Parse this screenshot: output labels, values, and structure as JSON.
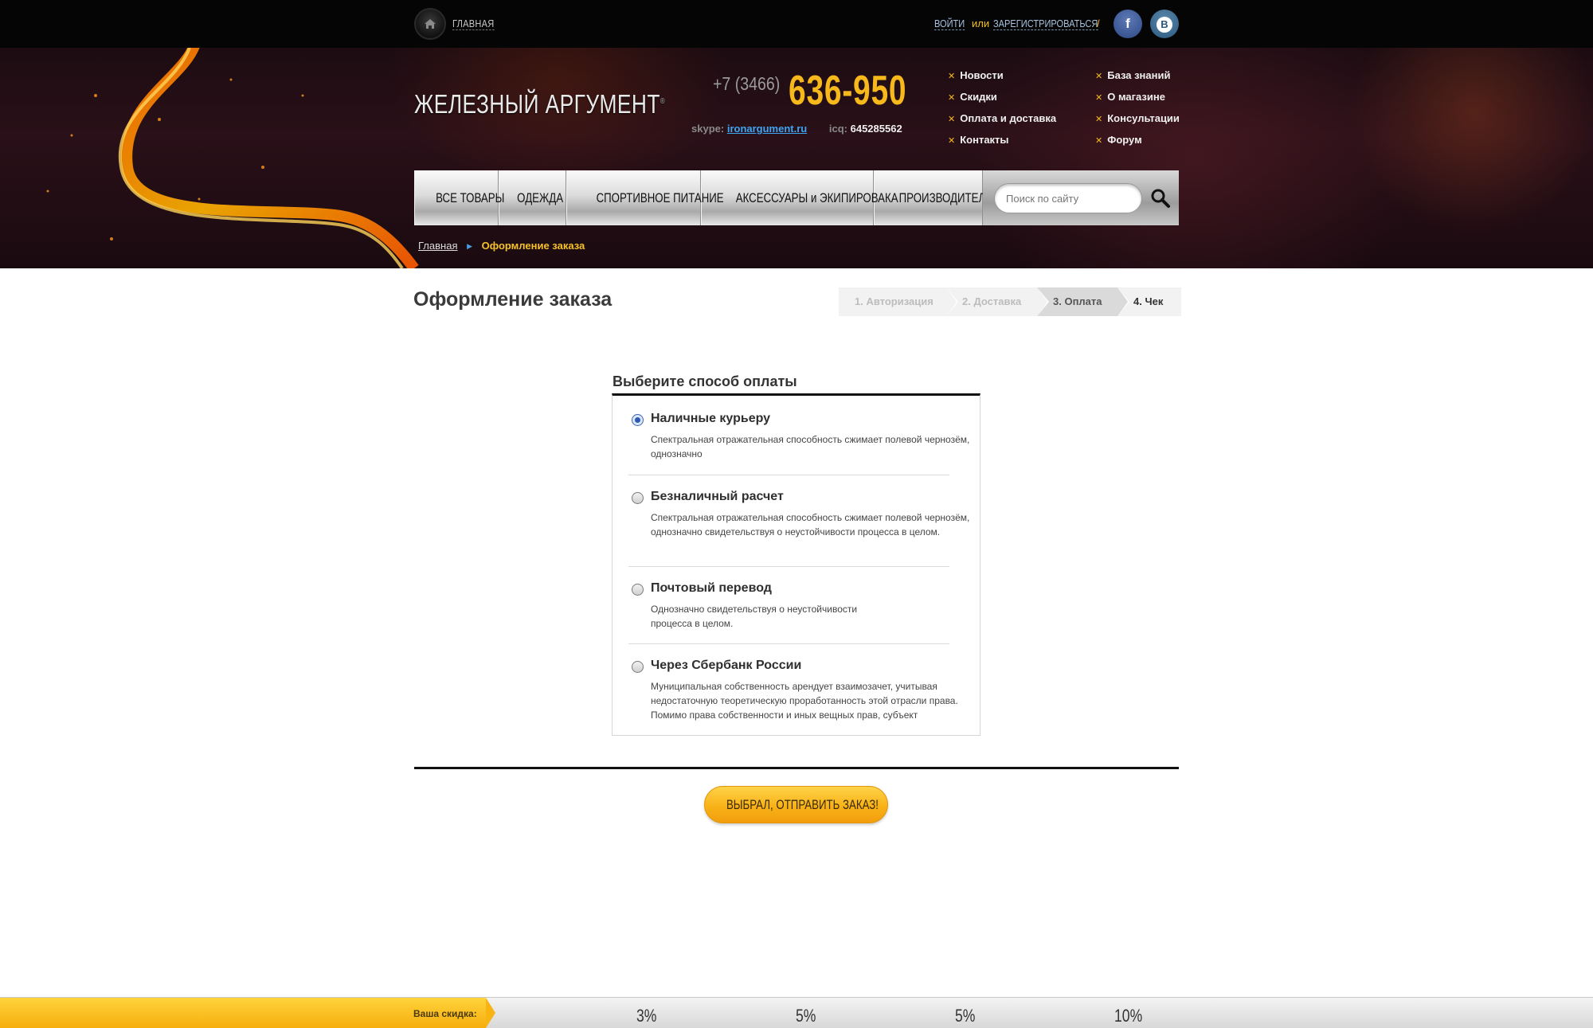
{
  "topbar": {
    "home_label": "ГЛАВНАЯ",
    "login_label": "ВОЙТИ",
    "or_label": "или",
    "register_label": "ЗАРЕГИСТРИРОВАТЬСЯ",
    "slash": "/",
    "facebook_glyph": "f",
    "vk_glyph": "В"
  },
  "header": {
    "logo": "ЖЕЛЕЗНЫЙ АРГУМЕНТ",
    "logo_mark": "®",
    "phone_code": "+7 (3466)",
    "phone_number": "636-950",
    "skype_label": "skype:",
    "skype_value": "ironargument.ru",
    "icq_label": "icq:",
    "icq_value": "645285562",
    "nav_col1": [
      "Новости",
      "Скидки",
      "Оплата и доставка",
      "Контакты"
    ],
    "nav_col2": [
      "База знаний",
      "О магазине",
      "Консультации",
      "Форум"
    ]
  },
  "mainnav": {
    "items": [
      "ВСЕ ТОВАРЫ",
      "ОДЕЖДА",
      "СПОРТИВНОЕ ПИТАНИЕ",
      "АКСЕССУАРЫ и ЭКИПИРОВАКА",
      "ПРОИЗВОДИТЕЛИ"
    ],
    "search_placeholder": "Поиск по сайту"
  },
  "breadcrumb": {
    "home": "Главная",
    "current": "Оформление заказа"
  },
  "page": {
    "title": "Оформление заказа",
    "steps": [
      "1. Авторизация",
      "2. Доставка",
      "3. Оплата",
      "4. Чек"
    ],
    "active_step": 3
  },
  "payment": {
    "title": "Выберите способ оплаты",
    "options": [
      {
        "label": "Наличные курьеру",
        "desc": "Спектральная отражательная способность сжимает полевой чернозём, однозначно",
        "checked": true
      },
      {
        "label": "Безналичный расчет",
        "desc": "Спектральная отражательная способность сжимает полевой чернозём, однозначно  свидетельствуя о неустойчивости процесса в целом.",
        "checked": false
      },
      {
        "label": "Почтовый перевод",
        "desc": "Однозначно свидетельствуя о неустойчивости процесса в целом.",
        "checked": false
      },
      {
        "label": "Через Сбербанк России",
        "desc": "Муниципальная собственность арендует взаимозачет, учитывая недостаточную теоретическую проработанность этой отрасли права. Помимо права собственности и иных вещных прав, субъект",
        "checked": false
      }
    ],
    "submit_label": "ВЫБРАЛ, ОТПРАВИТЬ ЗАКАЗ!"
  },
  "discount": {
    "label": "Ваша скидка:",
    "levels": [
      "3%",
      "5%",
      "5%",
      "10%"
    ]
  },
  "colors": {
    "accent_yellow": "#f6b81b",
    "link_blue": "#3ea6f3",
    "radio_checked": "#2b59b8"
  }
}
